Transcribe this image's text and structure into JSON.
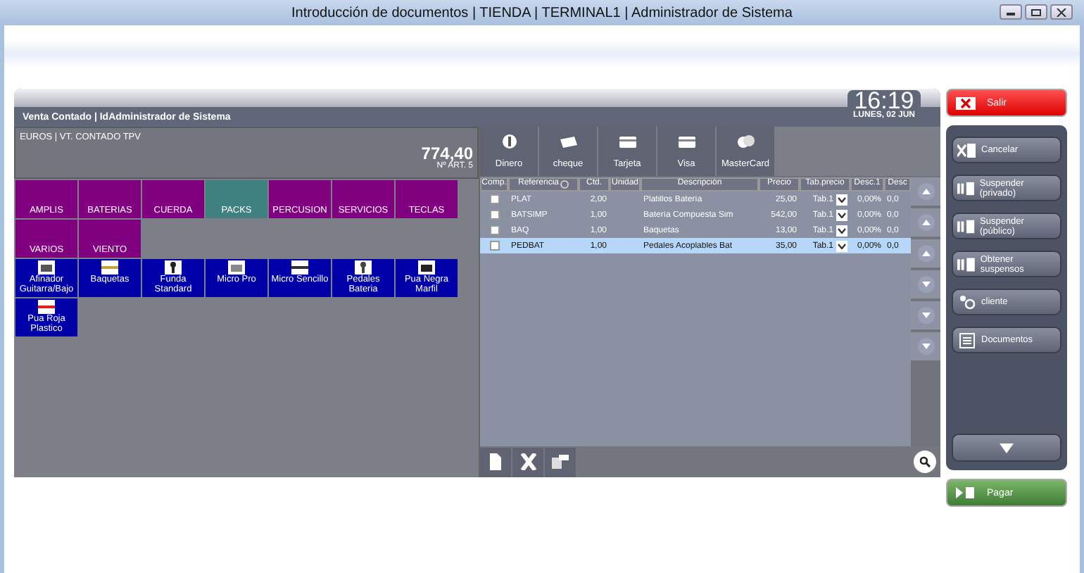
{
  "window": {
    "title": "Introducción de documentos | TIENDA | TERMINAL1 | Administrador de Sistema"
  },
  "header": {
    "title": "Venta Contado | IdAdministrador de Sistema",
    "time": "16:19",
    "date": "LUNES, 02 JUN"
  },
  "summary": {
    "label": "EUROS | VT. CONTADO TPV",
    "total": "774,40",
    "count": "Nº ART. 5"
  },
  "categories": [
    {
      "label": "AMPLIS",
      "selected": false
    },
    {
      "label": "BATERIAS",
      "selected": false
    },
    {
      "label": "CUERDA",
      "selected": false
    },
    {
      "label": "PACKS",
      "selected": true
    },
    {
      "label": "PERCUSION",
      "selected": false
    },
    {
      "label": "SERVICIOS",
      "selected": false
    },
    {
      "label": "TECLAS",
      "selected": false
    },
    {
      "label": "VARIOS",
      "selected": false
    },
    {
      "label": "VIENTO",
      "selected": false
    }
  ],
  "products": [
    {
      "label": "Afinador Guitarra/Bajo"
    },
    {
      "label": "Baquetas"
    },
    {
      "label": "Funda Standard"
    },
    {
      "label": "Micro Pro"
    },
    {
      "label": "Micro Sencillo"
    },
    {
      "label": "Pedales Bateria"
    },
    {
      "label": "Pua Negra Marfil"
    },
    {
      "label": "Pua Roja Plastico"
    }
  ],
  "payments": [
    {
      "label": "Dinero"
    },
    {
      "label": "cheque"
    },
    {
      "label": "Tarjeta"
    },
    {
      "label": "Visa"
    },
    {
      "label": "MasterCard"
    }
  ],
  "table": {
    "columns": [
      "Comp.",
      "Referencia",
      "Ctd.",
      "Unidad",
      "Descripción",
      "Precio",
      "Tab.precio",
      "Desc.1",
      "Desc"
    ],
    "rows": [
      {
        "checked": false,
        "selected": false,
        "ref": "PLAT",
        "qty": "2,00",
        "description": "Platillos Batería",
        "price": "25,00",
        "rate": "Tab.1",
        "disc1": "0,00%",
        "disc2": "0,0"
      },
      {
        "checked": false,
        "selected": false,
        "ref": "BATSIMP",
        "qty": "1,00",
        "description": "Batería Compuesta Sim",
        "price": "542,00",
        "rate": "Tab.1",
        "disc1": "0,00%",
        "disc2": "0,0"
      },
      {
        "checked": false,
        "selected": false,
        "ref": "BAQ",
        "qty": "1,00",
        "description": "Baquetas",
        "price": "13,00",
        "rate": "Tab.1",
        "disc1": "0,00%",
        "disc2": "0,0"
      },
      {
        "checked": false,
        "selected": true,
        "ref": "PEDBAT",
        "qty": "1,00",
        "description": "Pedales Acoplables Bat",
        "price": "35,00",
        "rate": "Tab.1",
        "disc1": "0,00%",
        "disc2": "0,0"
      }
    ]
  },
  "exit": {
    "label": "Salir"
  },
  "actions": [
    {
      "label": "Cancelar"
    },
    {
      "label": "Suspender (privado)"
    },
    {
      "label": "Suspender (público)"
    },
    {
      "label": "Obtener suspensos"
    },
    {
      "label": "cliente"
    },
    {
      "label": "Documentos"
    }
  ],
  "pay": {
    "label": "Pagar"
  }
}
